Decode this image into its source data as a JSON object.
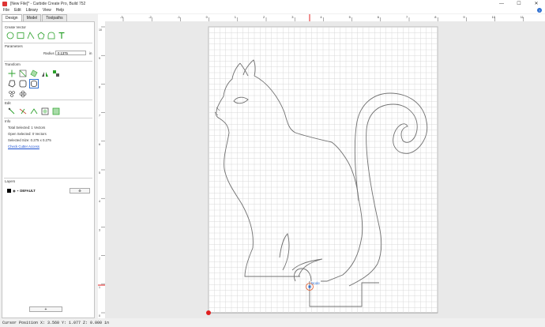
{
  "window": {
    "title": "[New File]* - Carbide Create Pro, Build 752",
    "controls": {
      "minimize": "—",
      "maximize": "☐",
      "close": "✕"
    }
  },
  "menu": [
    "File",
    "Edit",
    "Library",
    "View",
    "Help"
  ],
  "tabs": [
    "Design",
    "Model",
    "Toolpaths"
  ],
  "sections": {
    "create_vector": "Create Vector",
    "parameters": "Parameters",
    "transform": "Transform",
    "edit": "Edit",
    "info": "Info",
    "layers": "Layers"
  },
  "parameters": {
    "radius_label": "Radius",
    "radius_value": "0.1375",
    "unit": "in"
  },
  "info": {
    "total_selected": "Total Selected:  1 Vectors",
    "open_selected": "Open Selected:  0 Vectors",
    "selected_size": "Selected Size:   0.275 x 0.275",
    "check_cutter": "Check Cutter Access"
  },
  "layers": {
    "name": "DEFAULT",
    "add_label": "+"
  },
  "status": {
    "cursor": "Cursor Position X: 3.560 Y: 1.077 Z: 0.000 in"
  },
  "canvas": {
    "ruler_top_labels": [
      "-3",
      "-2",
      "-1",
      "0",
      "1",
      "2",
      "3",
      "4",
      "5",
      "6",
      "7",
      "8",
      "9",
      "10",
      "11"
    ],
    "ruler_left_labels": [
      "10",
      "9",
      "8",
      "7",
      "6",
      "5",
      "4",
      "3",
      "2",
      "1",
      "0"
    ],
    "node_label": "Node",
    "colors": {
      "grid": "#d9d9d9",
      "vector": "#707070",
      "node": "#e05a2c",
      "cursor_marker": "#e02020",
      "accent": "#2aa02a"
    }
  }
}
